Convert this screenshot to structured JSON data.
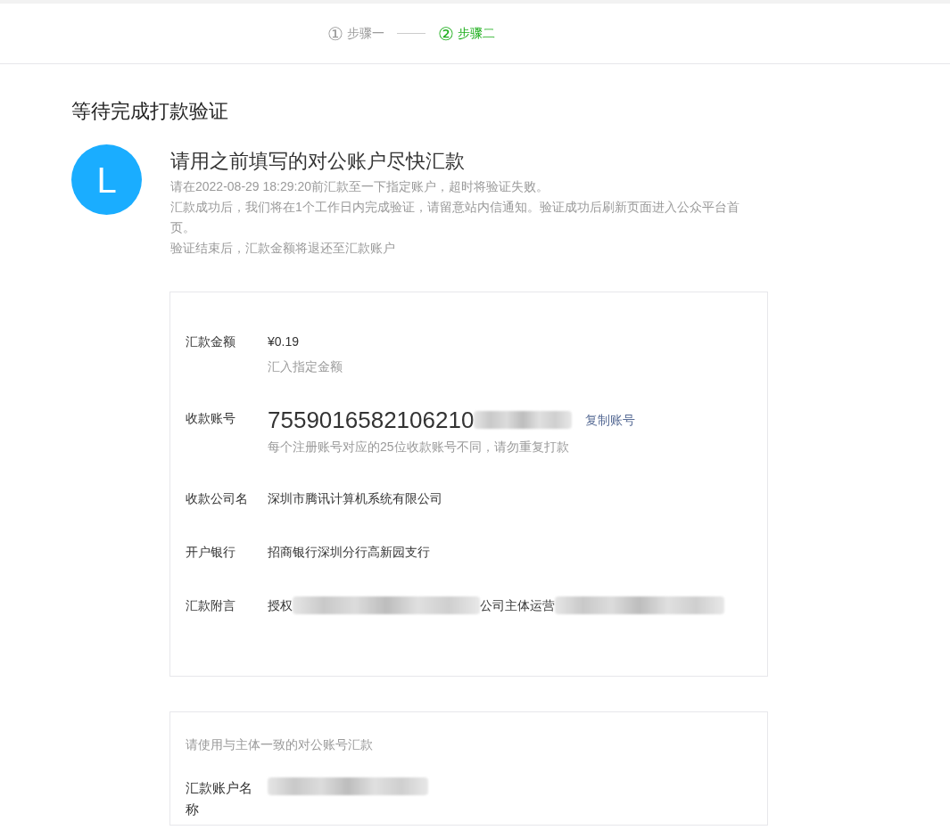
{
  "steps": [
    {
      "number": "①",
      "label": "步骤一",
      "selected": false
    },
    {
      "number": "②",
      "label": "步骤二",
      "selected": true
    }
  ],
  "page_title": "等待完成打款验证",
  "notice": {
    "avatar_letter": "L",
    "heading": "请用之前填写的对公账户尽快汇款",
    "lines": [
      "请在2022-08-29 18:29:20前汇款至一下指定账户，超时将验证失败。",
      "汇款成功后，我们将在1个工作日内完成验证，请留意站内信通知。验证成功后刷新页面进入公众平台首页。",
      "验证结束后，汇款金额将退还至汇款账户"
    ]
  },
  "payment_details": [
    {
      "kind": "amount",
      "label": "汇款金额",
      "value": "¥0.19",
      "hint": "汇入指定金额"
    },
    {
      "kind": "account",
      "label": "收款账号",
      "value": "7559016582106210",
      "redacted": true,
      "action": "复制账号",
      "hint": "每个注册账号对应的25位收款账号不同，请勿重复打款"
    },
    {
      "kind": "text",
      "label": "收款公司名",
      "value": "深圳市腾讯计算机系统有限公司"
    },
    {
      "kind": "text",
      "label": "开户银行",
      "value": "招商银行深圳分行高新园支行"
    },
    {
      "kind": "remark",
      "label": "汇款附言",
      "parts": [
        "授权",
        "公司主体运营"
      ]
    }
  ],
  "payer_section": {
    "note": "请使用与主体一致的对公账号汇款",
    "fields": [
      {
        "label": "汇款账户名称",
        "redacted": true
      }
    ]
  }
}
